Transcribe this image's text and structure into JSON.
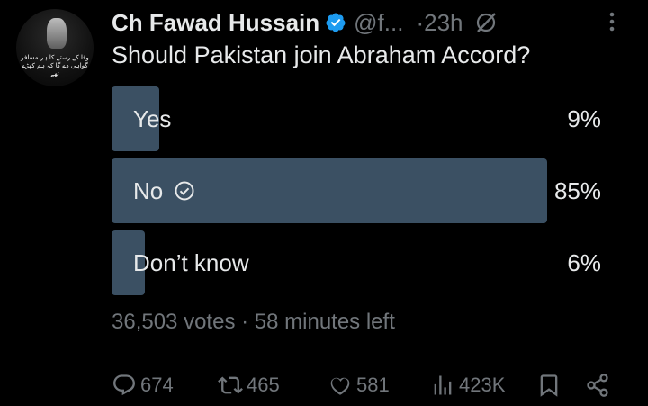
{
  "author": {
    "name": "Ch Fawad Hussain",
    "handle": "@f...",
    "separator": "·",
    "time": "23h",
    "avatar_caption": "وفا کے رستے کا ہر مسافر گواہی دے گا کہ ہم کھڑے تھے",
    "verified_color": "#1d9bf0",
    "icons": [
      "verified-badge-icon",
      "grok-icon",
      "more-icon"
    ]
  },
  "post": {
    "question": "Should Pakistan join Abraham Accord?"
  },
  "poll": {
    "options": [
      {
        "label": "Yes",
        "percent_text": "9%",
        "percent": 9,
        "winner": false
      },
      {
        "label": "No",
        "percent_text": "85%",
        "percent": 85,
        "winner": true
      },
      {
        "label": "Don’t know",
        "percent_text": "6%",
        "percent": 6,
        "winner": false
      }
    ],
    "bar_color": "#3b5063",
    "votes_text": "36,503 votes",
    "dot": "·",
    "time_left": "58 minutes left"
  },
  "actions": {
    "replies": "674",
    "reposts": "465",
    "likes": "581",
    "views": "423K",
    "icons": [
      "reply-icon",
      "repost-icon",
      "like-icon",
      "views-icon",
      "bookmark-icon",
      "share-icon"
    ]
  }
}
